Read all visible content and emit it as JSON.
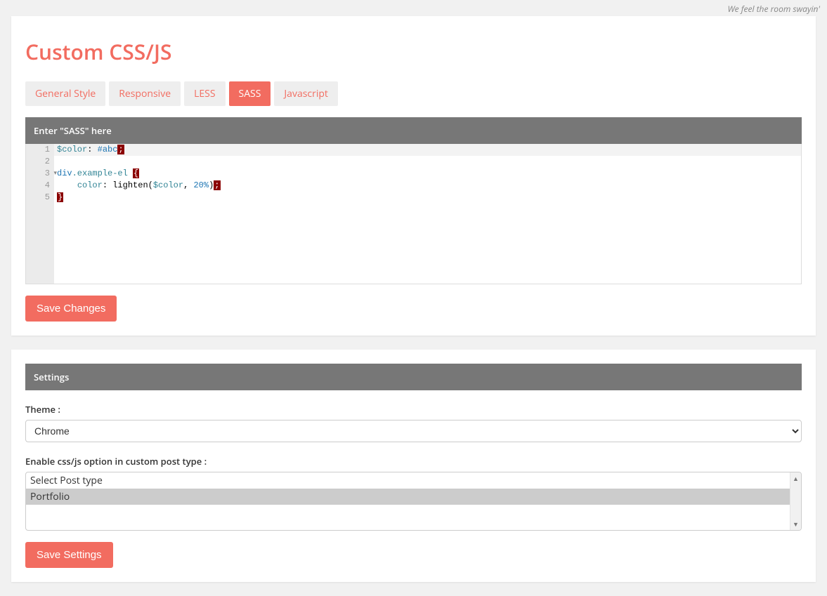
{
  "top_tagline": "We feel the room swayin'",
  "page_title": "Custom CSS/JS",
  "tabs": [
    {
      "label": "General Style",
      "active": false
    },
    {
      "label": "Responsive",
      "active": false
    },
    {
      "label": "LESS",
      "active": false
    },
    {
      "label": "SASS",
      "active": true
    },
    {
      "label": "Javascript",
      "active": false
    }
  ],
  "editor_header": "Enter \"SASS\" here",
  "code": {
    "line1_var": "$color",
    "line1_val": "#abc",
    "line1_term": ";",
    "line3_sel_tag": "div",
    "line3_sel_class": ".example-el",
    "line3_brace": "{",
    "line4_prop": "color",
    "line4_func": "lighten",
    "line4_arg1": "$color",
    "line4_arg2": "20%",
    "line4_term": ";",
    "line5_brace": "}"
  },
  "line_numbers": [
    "1",
    "2",
    "3",
    "4",
    "5"
  ],
  "save_changes_label": "Save Changes",
  "settings_header": "Settings",
  "theme_label": "Theme :",
  "theme_value": "Chrome",
  "posttype_label": "Enable css/js option in custom post type :",
  "posttype_options": [
    {
      "label": "Select Post type",
      "selected": false
    },
    {
      "label": "Portfolio",
      "selected": true
    }
  ],
  "save_settings_label": "Save Settings"
}
